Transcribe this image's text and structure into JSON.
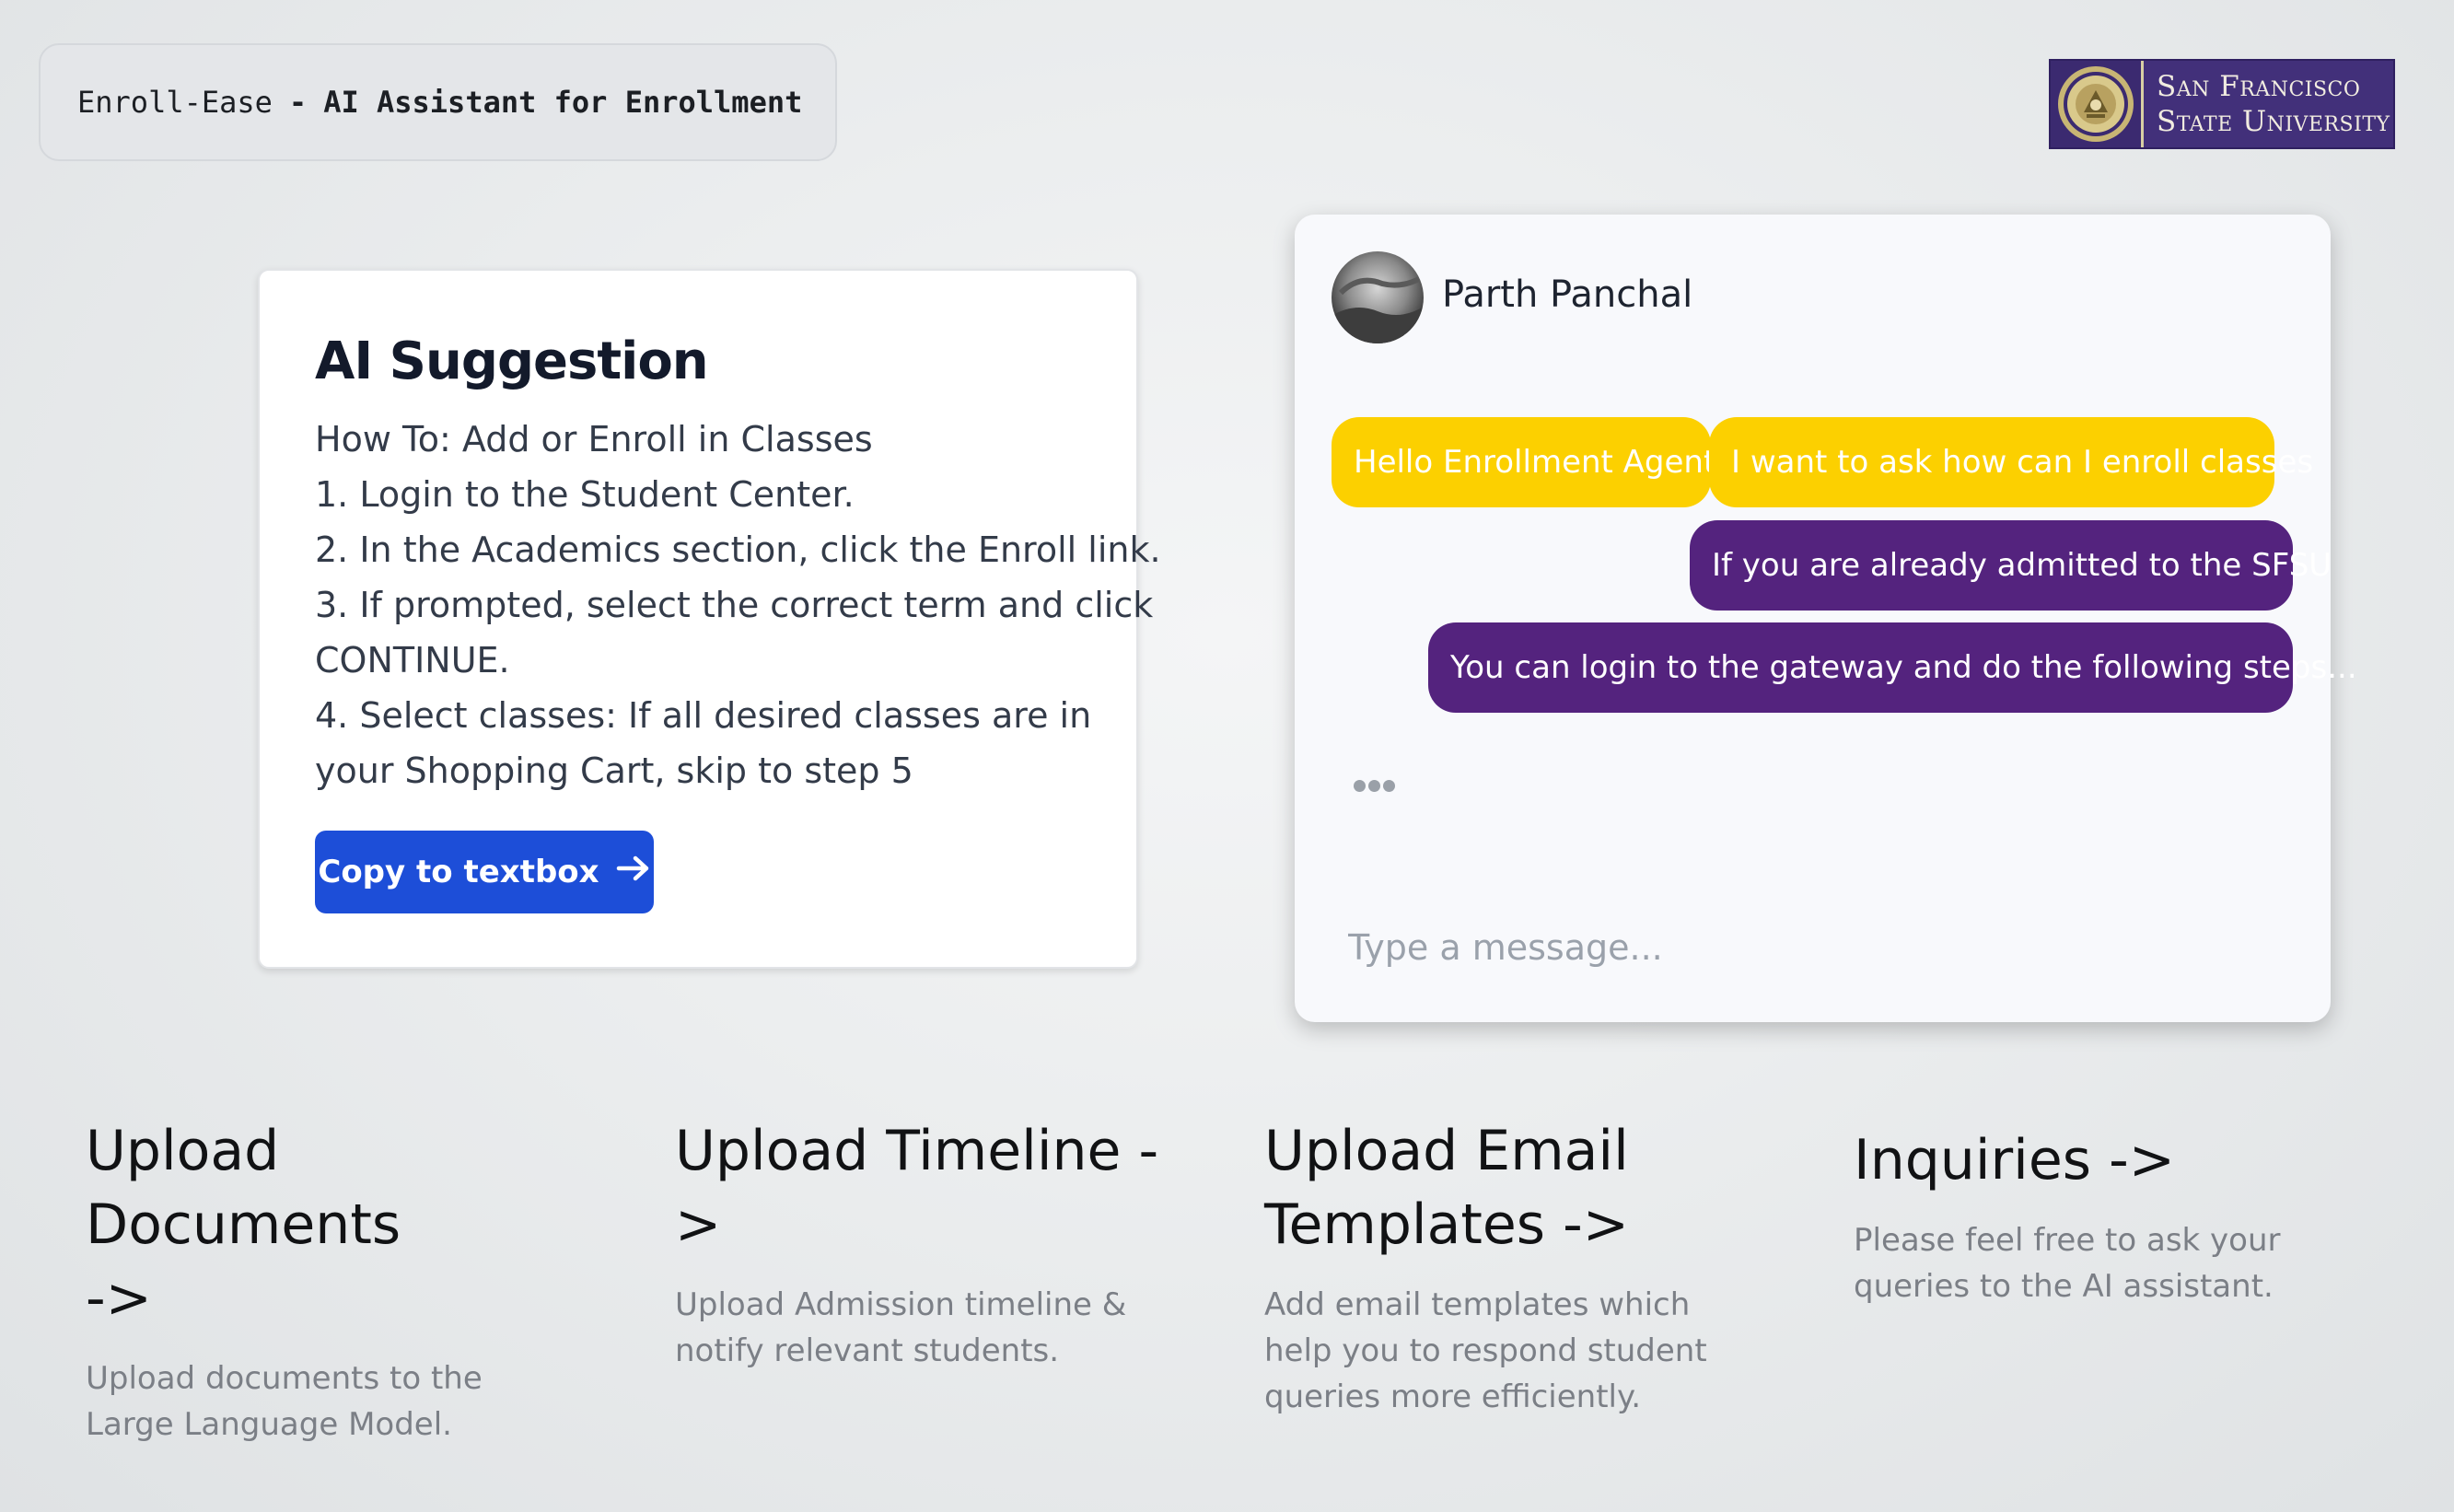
{
  "header": {
    "app_name": "Enroll-Ease",
    "separator": "-",
    "tagline": "AI Assistant for Enrollment"
  },
  "logo": {
    "line1": "San Francisco",
    "line2": "State University",
    "seal_icon": "university-seal-icon"
  },
  "suggestion": {
    "title": "AI Suggestion",
    "lines": [
      "How To: Add or Enroll in Classes",
      "1. Login to the Student Center.",
      "2. In the Academics section, click the Enroll link.",
      "3. If prompted, select the correct term and click",
      "CONTINUE.",
      "4. Select classes: If all desired classes are in",
      "your Shopping Cart, skip to step 5"
    ],
    "copy_button": "Copy to textbox",
    "copy_icon": "arrow-right-icon"
  },
  "chat": {
    "contact_name": "Parth Panchal",
    "messages": [
      {
        "from": "user",
        "text": "Hello Enrollment Agent"
      },
      {
        "from": "user",
        "text": "I want to ask how can I enroll classes"
      },
      {
        "from": "agent",
        "text": "If you are already admitted to the SFSU"
      },
      {
        "from": "agent",
        "text": "You can login to the gateway and do the following steps..."
      }
    ],
    "typing_indicator": "typing-dots-icon",
    "input_placeholder": "Type a message...",
    "colors": {
      "user_bubble": "#fcd000",
      "agent_bubble": "#54237e"
    }
  },
  "features": [
    {
      "title_line1": "Upload Documents",
      "title_line2": "->",
      "description": "Upload documents to the Large Language Model."
    },
    {
      "title_line1": "Upload Timeline ->",
      "title_line2": "",
      "description": "Upload Admission timeline & notify relevant students."
    },
    {
      "title_line1": "Upload Email",
      "title_line2": "Templates ->",
      "description": "Add email templates which help you to respond student queries more efficiently."
    },
    {
      "title_line1": "Inquiries ->",
      "title_line2": "",
      "description": "Please feel free to ask your queries to the AI assistant."
    }
  ],
  "colors": {
    "primary_button": "#1d4ed8",
    "logo_background": "#42307a"
  }
}
